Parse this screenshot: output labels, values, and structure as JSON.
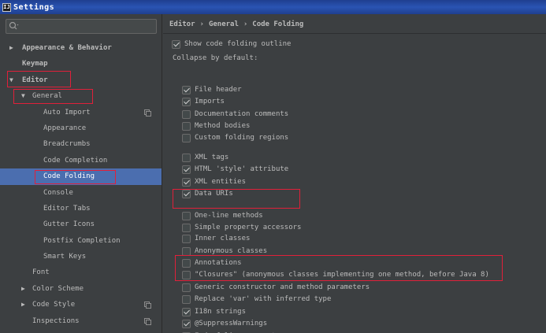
{
  "window": {
    "title": "Settings",
    "app_icon_text": "IJ"
  },
  "sidebar": {
    "search": {
      "placeholder": ""
    },
    "items": [
      {
        "label": "Appearance & Behavior",
        "arrow": "▶",
        "bold": true
      },
      {
        "label": "Keymap",
        "arrow": "",
        "bold": true
      },
      {
        "label": "Editor",
        "arrow": "▼",
        "bold": true
      },
      {
        "label": "General",
        "arrow": "▼",
        "bold": false
      },
      {
        "label": "Auto Import",
        "arrow": "",
        "bold": false,
        "copy": true
      },
      {
        "label": "Appearance",
        "arrow": "",
        "bold": false
      },
      {
        "label": "Breadcrumbs",
        "arrow": "",
        "bold": false
      },
      {
        "label": "Code Completion",
        "arrow": "",
        "bold": false
      },
      {
        "label": "Code Folding",
        "arrow": "",
        "bold": false,
        "selected": true
      },
      {
        "label": "Console",
        "arrow": "",
        "bold": false
      },
      {
        "label": "Editor Tabs",
        "arrow": "",
        "bold": false
      },
      {
        "label": "Gutter Icons",
        "arrow": "",
        "bold": false
      },
      {
        "label": "Postfix Completion",
        "arrow": "",
        "bold": false
      },
      {
        "label": "Smart Keys",
        "arrow": "",
        "bold": false
      },
      {
        "label": "Font",
        "arrow": "",
        "bold": false
      },
      {
        "label": "Color Scheme",
        "arrow": "▶",
        "bold": false
      },
      {
        "label": "Code Style",
        "arrow": "▶",
        "bold": false,
        "copy": true
      },
      {
        "label": "Inspections",
        "arrow": "",
        "bold": false,
        "copy": true
      }
    ]
  },
  "breadcrumb": {
    "part1": "Editor",
    "part2": "General",
    "part3": "Code Folding",
    "separator": "›"
  },
  "main": {
    "show_outline": {
      "label": "Show code folding outline",
      "checked": true
    },
    "collapse_label": "Collapse by default:",
    "options": [
      {
        "label": "File header",
        "checked": true
      },
      {
        "label": "Imports",
        "checked": true
      },
      {
        "label": "Documentation comments",
        "checked": false
      },
      {
        "label": "Method bodies",
        "checked": false
      },
      {
        "label": "Custom folding regions",
        "checked": false
      },
      {
        "label": "XML tags",
        "checked": false
      },
      {
        "label": "HTML 'style' attribute",
        "checked": true
      },
      {
        "label": "XML entities",
        "checked": true
      },
      {
        "label": "Data URIs",
        "checked": true
      },
      {
        "label": "One-line methods",
        "checked": false
      },
      {
        "label": "Simple property accessors",
        "checked": false
      },
      {
        "label": "Inner classes",
        "checked": false
      },
      {
        "label": "Anonymous classes",
        "checked": false
      },
      {
        "label": "Annotations",
        "checked": false
      },
      {
        "label": "\"Closures\" (anonymous classes implementing one method, before Java 8)",
        "checked": false
      },
      {
        "label": "Generic constructor and method parameters",
        "checked": false
      },
      {
        "label": "Replace 'var' with inferred type",
        "checked": false
      },
      {
        "label": "I18n strings",
        "checked": true
      },
      {
        "label": "@SuppressWarnings",
        "checked": true
      },
      {
        "label": "End of line comments sequence",
        "checked": false
      }
    ]
  },
  "colors": {
    "background": "#3c3f41",
    "selection": "#4b6eaf",
    "highlight": "#e0203a",
    "titlebar": "#2a54b3"
  }
}
